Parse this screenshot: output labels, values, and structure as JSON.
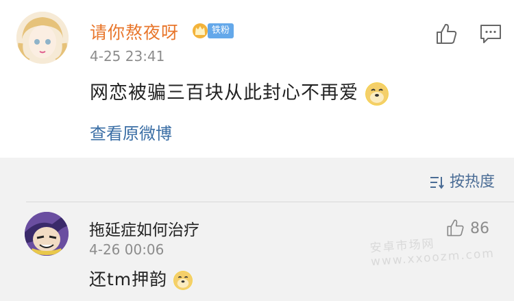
{
  "post": {
    "username": "请你熬夜呀",
    "fan_badge": "铁粉",
    "time": "4-25 23:41",
    "content": "网恋被骗三百块从此封心不再爱",
    "view_original": "查看原微博"
  },
  "toolbar": {
    "sort_label": "按热度"
  },
  "comment": {
    "username": "拖延症如何治疗",
    "time": "4-26 00:06",
    "content": "还tm押韵",
    "likes": "86"
  },
  "watermark": "安卓市场网 www.xxoozm.com",
  "colors": {
    "username": "#e8762b",
    "link": "#3a6ea5",
    "badge": "#64a8ea"
  },
  "icons": [
    "crown-icon",
    "like-icon",
    "comment-icon",
    "doge-emoji-icon",
    "sort-icon"
  ]
}
